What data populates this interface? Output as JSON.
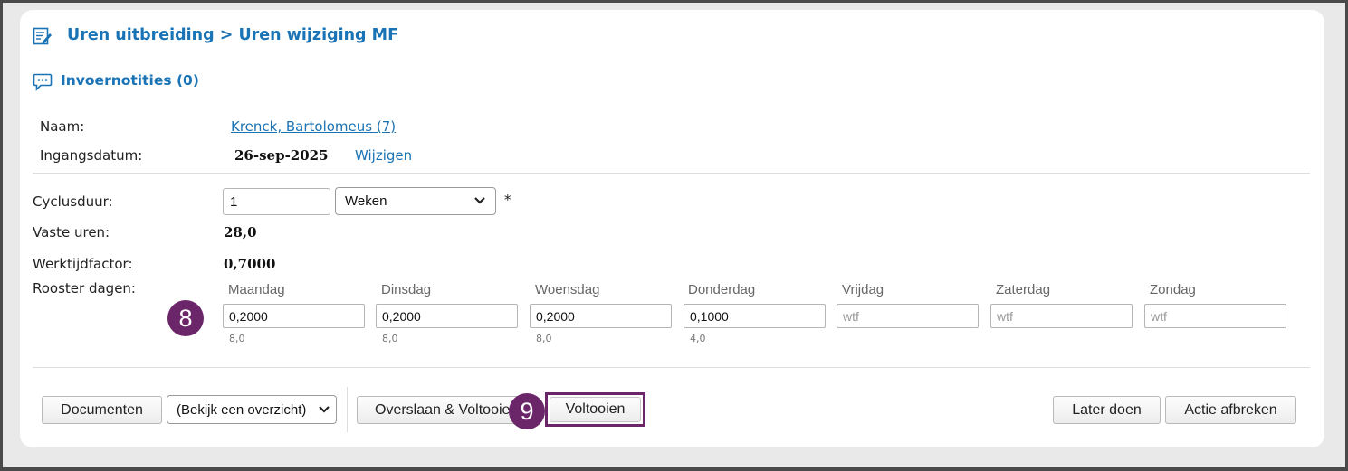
{
  "header": {
    "title": "Uren uitbreiding > Uren wijziging MF",
    "notes_label": "Invoernotities (0)"
  },
  "info": {
    "name_label": "Naam:",
    "name_value": "Krenck, Bartolomeus (7)",
    "date_label": "Ingangsdatum:",
    "date_value": "26-sep-2025",
    "change_link": "Wijzigen"
  },
  "form": {
    "cycle_label": "Cyclusduur:",
    "cycle_value": "1",
    "cycle_unit": "Weken",
    "required_mark": "*",
    "fixed_hours_label": "Vaste uren:",
    "fixed_hours_value": "28,0",
    "factor_label": "Werktijdfactor:",
    "factor_value": "0,7000",
    "roster_label": "Rooster dagen:"
  },
  "days": [
    {
      "name": "Maandag",
      "value": "0,2000",
      "hours": "8,0"
    },
    {
      "name": "Dinsdag",
      "value": "0,2000",
      "hours": "8,0"
    },
    {
      "name": "Woensdag",
      "value": "0,2000",
      "hours": "8,0"
    },
    {
      "name": "Donderdag",
      "value": "0,1000",
      "hours": "4,0"
    },
    {
      "name": "Vrijdag",
      "placeholder": "wtf"
    },
    {
      "name": "Zaterdag",
      "placeholder": "wtf"
    },
    {
      "name": "Zondag",
      "placeholder": "wtf"
    }
  ],
  "badges": {
    "step8": "8",
    "step9": "9"
  },
  "footer": {
    "documents_button": "Documenten",
    "overview_select": "(Bekijk een overzicht)",
    "skip_complete_button": "Overslaan & Voltooien",
    "complete_button": "Voltooien",
    "later_button": "Later doen",
    "cancel_button": "Actie afbreken"
  },
  "colors": {
    "accent": "#1a73b5",
    "badge": "#6b2569",
    "highlight_border": "#6b2569"
  }
}
